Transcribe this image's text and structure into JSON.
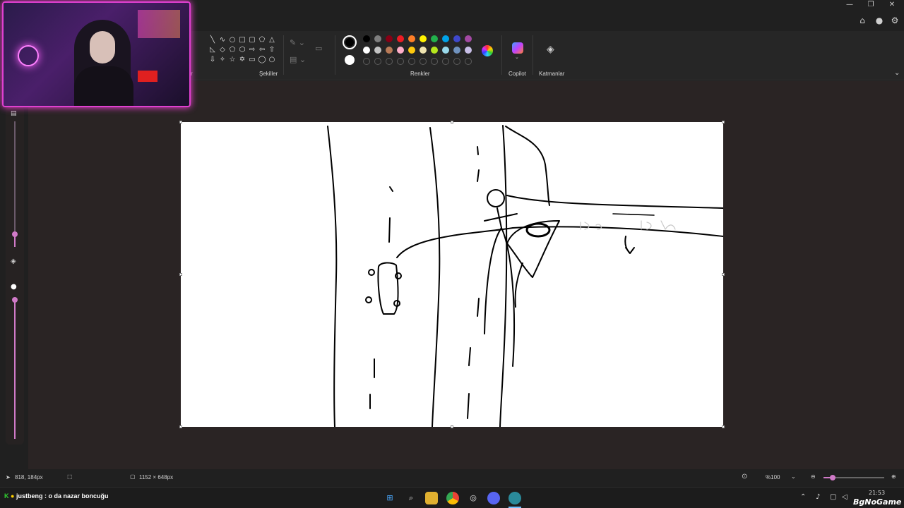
{
  "ribbon": {
    "shapes_label": "Şekiller",
    "colors_label": "Renkler",
    "copilot_label": "Copilot",
    "layers_label": "Katmanlar",
    "cut_label": "r"
  },
  "palette": {
    "row1": [
      "#000000",
      "#7f7f7f",
      "#880015",
      "#ed1c24",
      "#ff7f27",
      "#fff200",
      "#22b14c",
      "#00a2e8",
      "#3f48cc",
      "#a349a4"
    ],
    "row2": [
      "#ffffff",
      "#c3c3c3",
      "#b97a57",
      "#ffaec9",
      "#ffc90e",
      "#efe4b0",
      "#b5e61d",
      "#99d9ea",
      "#7092be",
      "#c8bfe7"
    ],
    "primary": "#000000",
    "secondary": "#ffffff"
  },
  "status": {
    "cursor_pos": "818, 184px",
    "canvas_size": "1152 × 648px",
    "zoom": "%100"
  },
  "chat": {
    "user": "justbeng",
    "message": " : o da nazar boncuğu"
  },
  "tray": {
    "time": "21:53",
    "watermark": "BgNoGame"
  },
  "icons": {
    "minimize": "minimize-icon",
    "maximize": "maximize-icon",
    "close": "close-icon",
    "copilot": "copilot-icon",
    "layers": "layers-icon"
  }
}
